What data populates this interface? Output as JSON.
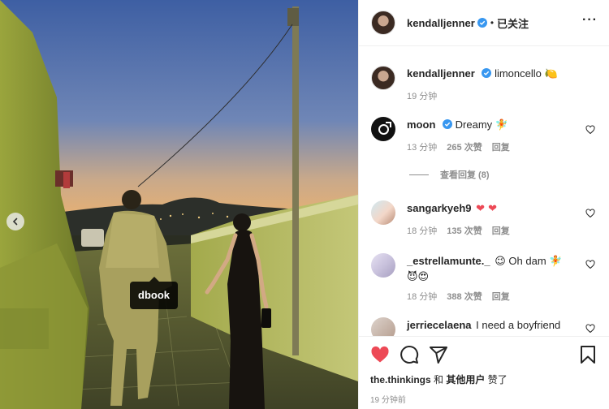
{
  "post": {
    "photo_tag": "dbook",
    "prev_arrow_icon": "chevron-left-icon"
  },
  "header": {
    "username": "kendalljenner",
    "separator": "•",
    "follow_status": "已关注",
    "more_icon": "more-icon"
  },
  "caption": {
    "username": "kendalljenner",
    "text": "limoncello",
    "emoji": "🍋",
    "time": "19 分钟"
  },
  "comments": [
    {
      "username": "moon",
      "verified": true,
      "text": "Dreamy",
      "emoji": "🧚",
      "time": "13 分钟",
      "likes": "265 次赞",
      "reply": "回复"
    },
    {
      "username": "sangarkyeh9",
      "verified": false,
      "text": "",
      "emoji": "❤ ❤",
      "time": "18 分钟",
      "likes": "135 次赞",
      "reply": "回复"
    },
    {
      "username": "_estrellamunte._",
      "verified": false,
      "text": "Oh dam",
      "emoji_pre": "😉",
      "emoji_post": "🧚",
      "emoji_line2": "😈😍",
      "time": "18 分钟",
      "likes": "388 次赞",
      "reply": "回复"
    },
    {
      "username": "jerriecelaena",
      "verified": false,
      "text": "I need a boyfriend",
      "time": "",
      "likes": "",
      "reply": ""
    }
  ],
  "view_replies": "查看回复 (8)",
  "likes_line": {
    "user": "the.thinkings",
    "and": "和",
    "others": "其他用户",
    "suffix": "赞了"
  },
  "post_time": "19 分钟前",
  "colors": {
    "verified_blue": "#3897f0",
    "like_red": "#ed4956",
    "secondary_text": "#8e8e8e"
  }
}
